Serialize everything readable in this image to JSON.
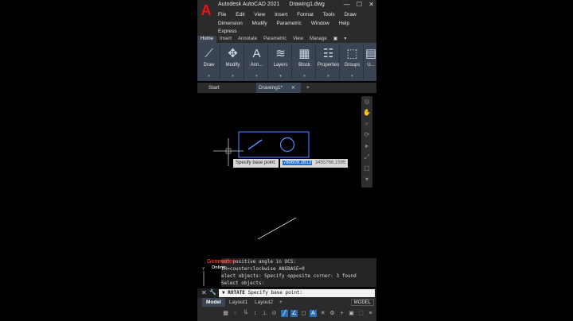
{
  "window": {
    "title_app": "Autodesk AutoCAD 2021",
    "title_file": "Drawing1.dwg",
    "controls": [
      "—",
      "☐",
      "✕"
    ]
  },
  "menu": {
    "row1": [
      "File",
      "Edit",
      "View",
      "Insert",
      "Format",
      "Tools",
      "Draw"
    ],
    "row2": [
      "Dimension",
      "Modify",
      "Parametric",
      "Window",
      "Help"
    ],
    "row3": [
      "Express"
    ]
  },
  "ribbon_tabs": [
    "Home",
    "Insert",
    "Annotate",
    "Parametric",
    "View",
    "Manage",
    "▣",
    "▾"
  ],
  "ribbon_panels": [
    {
      "label": "Draw",
      "icon": "line-draw-icon",
      "glyph": "⟋"
    },
    {
      "label": "Modify",
      "icon": "move-arrows-icon",
      "glyph": "✥"
    },
    {
      "label": "Ann...",
      "icon": "annotation-text-icon",
      "glyph": "A"
    },
    {
      "label": "Layers",
      "icon": "layers-icon",
      "glyph": "≋"
    },
    {
      "label": "Block",
      "icon": "block-icon",
      "glyph": "▦"
    },
    {
      "label": "Properties",
      "icon": "properties-icon",
      "glyph": "☷"
    },
    {
      "label": "Groups",
      "icon": "groups-icon",
      "glyph": "⬚"
    },
    {
      "label": "U...",
      "icon": "utilities-icon",
      "glyph": "▤"
    }
  ],
  "file_tabs": {
    "start": "Start",
    "drawing": "Drawing1*",
    "close": "✕",
    "add": "+"
  },
  "dynamic_input": {
    "prompt": "Specify base point:",
    "x_value": "780609.2813",
    "y_value": "3455766.1595"
  },
  "command_history": [
    "ent positive angle in UCS:",
    "IR=counterclockwise  ANGBASE=0",
    "elect objects: Specify opposite corner: 3 found",
    "Select objects:"
  ],
  "watermark": {
    "line1": "Geomatics",
    "line2": "Online"
  },
  "command_line": {
    "close_btn": "✕",
    "tool_btn": "🔧",
    "command": "ROTATE",
    "prompt": "Specify base point:",
    "arrow": "▼"
  },
  "layout_tabs": [
    "Model",
    "Layout1",
    "Layout2",
    "+"
  ],
  "status_model": "MODEL",
  "colors": {
    "ribbon_bg": "#3b4453",
    "selection_box": "#4a6cff",
    "entity_line": "#d0d0d0",
    "highlight_blue": "#1a6fd6",
    "logo_red": "#e11111"
  }
}
